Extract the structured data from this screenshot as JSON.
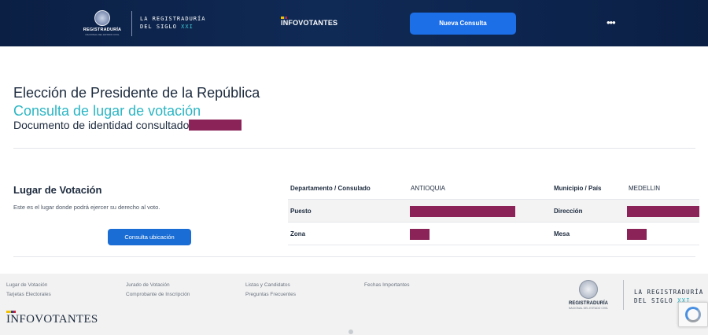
{
  "header": {
    "seal_text": "REGISTRADURÍA",
    "seal_subtext": "NACIONAL DEL ESTADO CIVIL",
    "siglo_line1": "LA REGISTRADURÍA",
    "siglo_line2": "DEL SIGLO",
    "siglo_xxi": "XXI",
    "infovotantes": "INFOVOTANTES",
    "nueva_consulta": "Nueva Consulta",
    "more": "•••"
  },
  "main": {
    "title": "Elección de Presidente de la República",
    "subtitle": "Consulta de lugar de votación",
    "doc_label": "Documento de identidad consultado:"
  },
  "lugar": {
    "title": "Lugar de Votación",
    "description": "Este es el lugar donde podrá ejercer su derecho al voto.",
    "button": "Consulta ubicación"
  },
  "table": {
    "row1": {
      "label1": "Departamento / Consulado",
      "value1": "ANTIOQUIA",
      "label2": "Municipio / País",
      "value2": "MEDELLIN"
    },
    "row2": {
      "label1": "Puesto",
      "label2": "Dirección"
    },
    "row3": {
      "label1": "Zona",
      "label2": "Mesa"
    }
  },
  "footer": {
    "links_col1": [
      "Lugar de Votación",
      "Tarjetas Electorales"
    ],
    "links_col2": [
      "Jurado de Votación",
      "Comprobante de Inscripción"
    ],
    "links_col3": [
      "Listas y Candidatos",
      "Preguntas Frecuentes"
    ],
    "links_col4": [
      "Fechas Importantes"
    ],
    "infovotantes": "INFOVOTANTES",
    "seal_text": "REGISTRADURÍA",
    "seal_subtext": "NACIONAL DEL ESTADO CIVIL",
    "siglo_line1": "LA REGISTRADURÍA",
    "siglo_line2": "DEL SIGLO",
    "siglo_xxi": "XXI"
  },
  "colors": {
    "header_bg": "#0b1f44",
    "accent_teal": "#2bb6c4",
    "button_blue": "#1d6fe8",
    "redaction": "#8b2358"
  }
}
